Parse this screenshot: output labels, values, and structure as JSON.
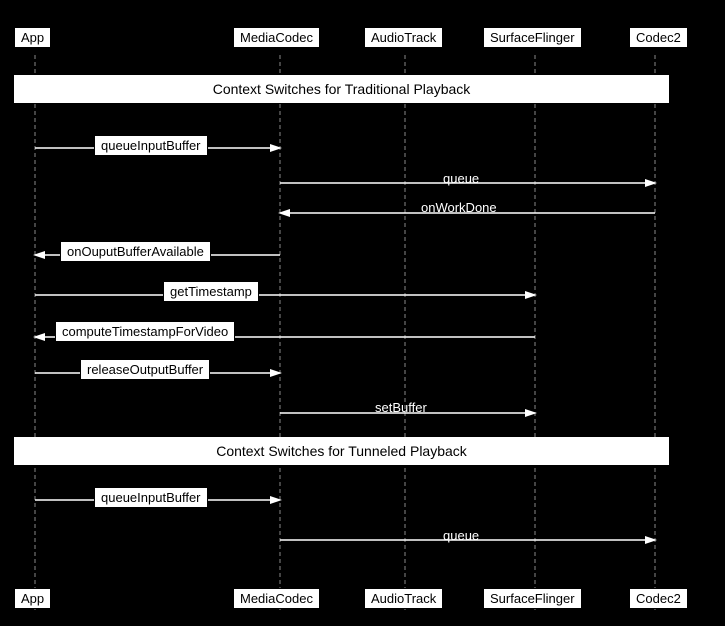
{
  "header_actors": {
    "app": "App",
    "mediacodec": "MediaCodec",
    "audiotrack": "AudioTrack",
    "surfaceflinger": "SurfaceFlinger",
    "codec2": "Codec2"
  },
  "footer_actors": {
    "app": "App",
    "mediacodec": "MediaCodec",
    "audiotrack": "AudioTrack",
    "surfaceflinger": "SurfaceFlinger",
    "codec2": "Codec2"
  },
  "section1": {
    "title": "Context Switches for Traditional Playback"
  },
  "section2": {
    "title": "Context Switches for Tunneled Playback"
  },
  "calls": {
    "queueInputBuffer1": "queueInputBuffer",
    "queue1": "queue",
    "onWorkDone": "onWorkDone",
    "onOuputBufferAvailable": "onOuputBufferAvailable",
    "getTimestamp": "getTimestamp",
    "computeTimestampForVideo": "computeTimestampForVideo",
    "releaseOutputBuffer": "releaseOutputBuffer",
    "setBuffer": "setBuffer",
    "queueInputBuffer2": "queueInputBuffer",
    "queue2": "queue"
  }
}
